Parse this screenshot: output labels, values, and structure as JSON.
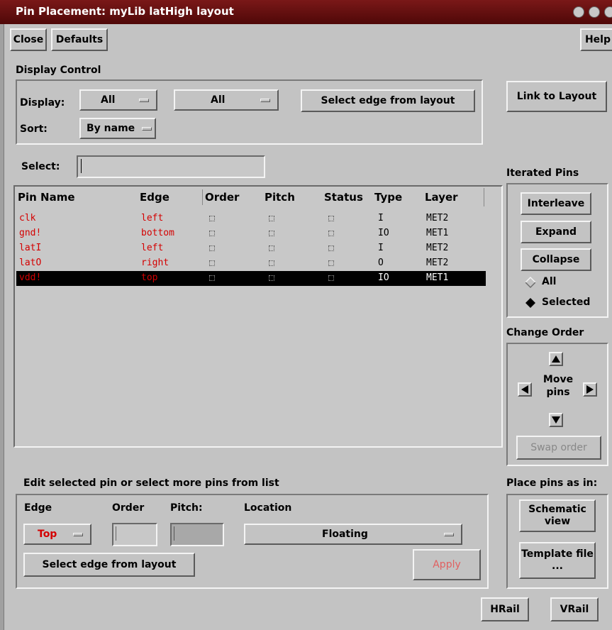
{
  "window": {
    "title": "Pin Placement: myLib latHigh layout"
  },
  "toolbar": {
    "close": "Close",
    "defaults": "Defaults",
    "help": "Help"
  },
  "display_control": {
    "heading": "Display Control",
    "display_label": "Display:",
    "display_value_1": "All",
    "display_value_2": "All",
    "select_edge_button": "Select edge from layout",
    "sort_label": "Sort:",
    "sort_value": "By name"
  },
  "link_to_layout": "Link to Layout",
  "select": {
    "label": "Select:",
    "value": ""
  },
  "table": {
    "columns": [
      "Pin Name",
      "Edge",
      "Order",
      "Pitch",
      "Status",
      "Type",
      "Layer"
    ],
    "rows": [
      {
        "name": "clk",
        "edge": "left",
        "type": "I",
        "layer": "MET2",
        "selected": false
      },
      {
        "name": "gnd!",
        "edge": "bottom",
        "type": "IO",
        "layer": "MET1",
        "selected": false
      },
      {
        "name": "latI",
        "edge": "left",
        "type": "I",
        "layer": "MET2",
        "selected": false
      },
      {
        "name": "latO",
        "edge": "right",
        "type": "O",
        "layer": "MET2",
        "selected": false
      },
      {
        "name": "vdd!",
        "edge": "top",
        "type": "IO",
        "layer": "MET1",
        "selected": true
      }
    ]
  },
  "iterated_pins": {
    "heading": "Iterated Pins",
    "interleave": "Interleave",
    "expand": "Expand",
    "collapse": "Collapse",
    "radio_all": "All",
    "radio_selected": "Selected",
    "selected_option": "Selected"
  },
  "change_order": {
    "heading": "Change Order",
    "move_pins": "Move pins",
    "swap_order": "Swap order"
  },
  "edit": {
    "heading": "Edit selected pin or select more pins from list",
    "edge_label": "Edge",
    "order_label": "Order",
    "pitch_label": "Pitch:",
    "location_label": "Location",
    "edge_value": "Top",
    "order_value": "",
    "pitch_value": "",
    "location_value": "Floating",
    "select_edge_button": "Select edge from layout",
    "apply": "Apply"
  },
  "place_pins": {
    "heading": "Place pins as in:",
    "schematic": "Schematic view",
    "template": "Template file ..."
  },
  "rails": {
    "hrail": "HRail",
    "vrail": "VRail"
  },
  "colors": {
    "title_bar": "#6a1010",
    "pin_text": "#d40000",
    "disabled_text": "#e06060"
  }
}
